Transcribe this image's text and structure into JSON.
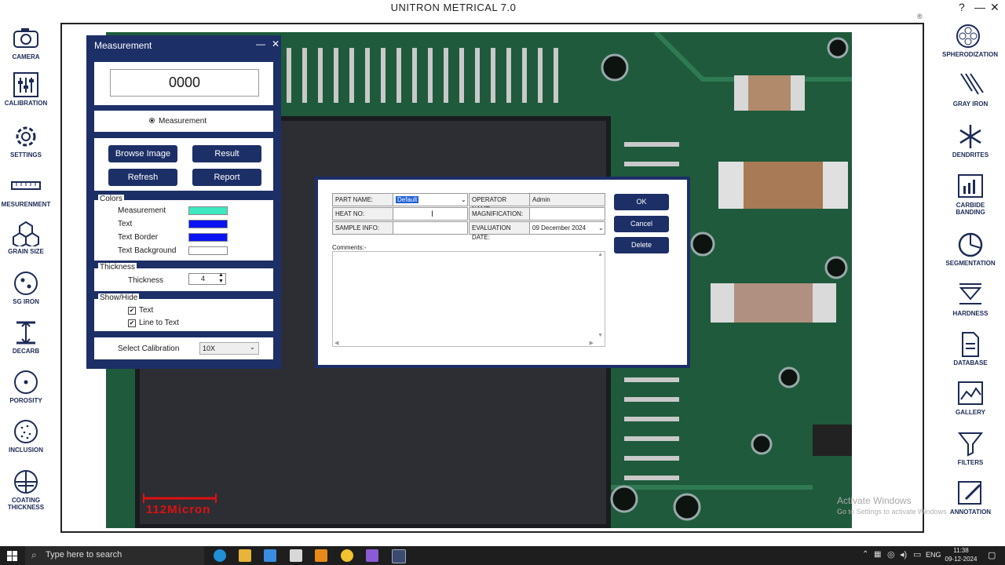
{
  "app": {
    "title": "UNITRON METRICAL 7.0",
    "help": "?",
    "minimize": "—",
    "close": "✕"
  },
  "left_tools": [
    {
      "label": "CAMERA",
      "icon": "camera-icon"
    },
    {
      "label": "CALIBRATION",
      "icon": "calibration-icon"
    },
    {
      "label": "SETTINGS",
      "icon": "gear-icon"
    },
    {
      "label": "MESURENMENT",
      "icon": "ruler-icon"
    },
    {
      "label": "GRAIN SIZE",
      "icon": "hexagon-icon"
    },
    {
      "label": "SG IRON",
      "icon": "sg-iron-icon"
    },
    {
      "label": "DECARB",
      "icon": "decarb-icon"
    },
    {
      "label": "POROSITY",
      "icon": "porosity-icon"
    },
    {
      "label": "INCLUSION",
      "icon": "inclusion-icon"
    },
    {
      "label": "COATING THICKNESS",
      "icon": "coating-icon"
    }
  ],
  "right_tools": [
    {
      "label": "SPHERODIZATION",
      "icon": "spherodization-icon"
    },
    {
      "label": "GRAY IRON",
      "icon": "gray-iron-icon"
    },
    {
      "label": "DENDRITES",
      "icon": "snowflake-icon"
    },
    {
      "label": "CARBIDE BANDING",
      "icon": "bar-chart-icon"
    },
    {
      "label": "SEGMENTATION",
      "icon": "pie-chart-icon"
    },
    {
      "label": "HARDNESS",
      "icon": "hardness-icon"
    },
    {
      "label": "DATABASE",
      "icon": "document-icon"
    },
    {
      "label": "GALLERY",
      "icon": "gallery-icon"
    },
    {
      "label": "FILTERS",
      "icon": "funnel-icon"
    },
    {
      "label": "ANNOTATION",
      "icon": "pencil-icon"
    }
  ],
  "measurement_panel": {
    "title": "Measurement",
    "minimize": "—",
    "close": "✕",
    "value": "0000",
    "mode_radio": "Measurement",
    "buttons": {
      "browse": "Browse Image",
      "result": "Result",
      "refresh": "Refresh",
      "report": "Report"
    },
    "colors_group": "Colors",
    "colors": [
      {
        "label": "Measurement",
        "color": "#3de8c0"
      },
      {
        "label": "Text",
        "color": "#0a14f0"
      },
      {
        "label": "Text Border",
        "color": "#0a14f0"
      },
      {
        "label": "Text Background",
        "color": "#ffffff"
      }
    ],
    "thickness_group": "Thickness",
    "thickness_label": "Thickness",
    "thickness_value": "4",
    "showhide_group": "Show/Hide",
    "show_text": "Text",
    "show_line": "Line to Text",
    "calib_label": "Select Calibration",
    "calib_value": "10X"
  },
  "dialog": {
    "part_name_label": "PART NAME:",
    "part_name_value": "Default",
    "operator_label": "OPERATOR NAME:",
    "operator_value": "Admin",
    "heat_label": "HEAT NO:",
    "magnification_label": "MAGNIFICATION:",
    "sample_label": "SAMPLE INFO:",
    "eval_label": "EVALUATION DATE:",
    "eval_value": "09 December 2024",
    "comments_label": "Comments:-",
    "ok": "OK",
    "cancel": "Cancel",
    "delete": "Delete"
  },
  "scale_bar": "112Micron",
  "watermark": {
    "line1": "Activate Windows",
    "line2": "Go to Settings to activate Windows."
  },
  "taskbar": {
    "search_placeholder": "Type here to search",
    "lang": "ENG",
    "time": "11:38",
    "date": "09-12-2024"
  },
  "colors": {
    "accent": "#1d2f67",
    "pcb": "#1f5a3c"
  }
}
